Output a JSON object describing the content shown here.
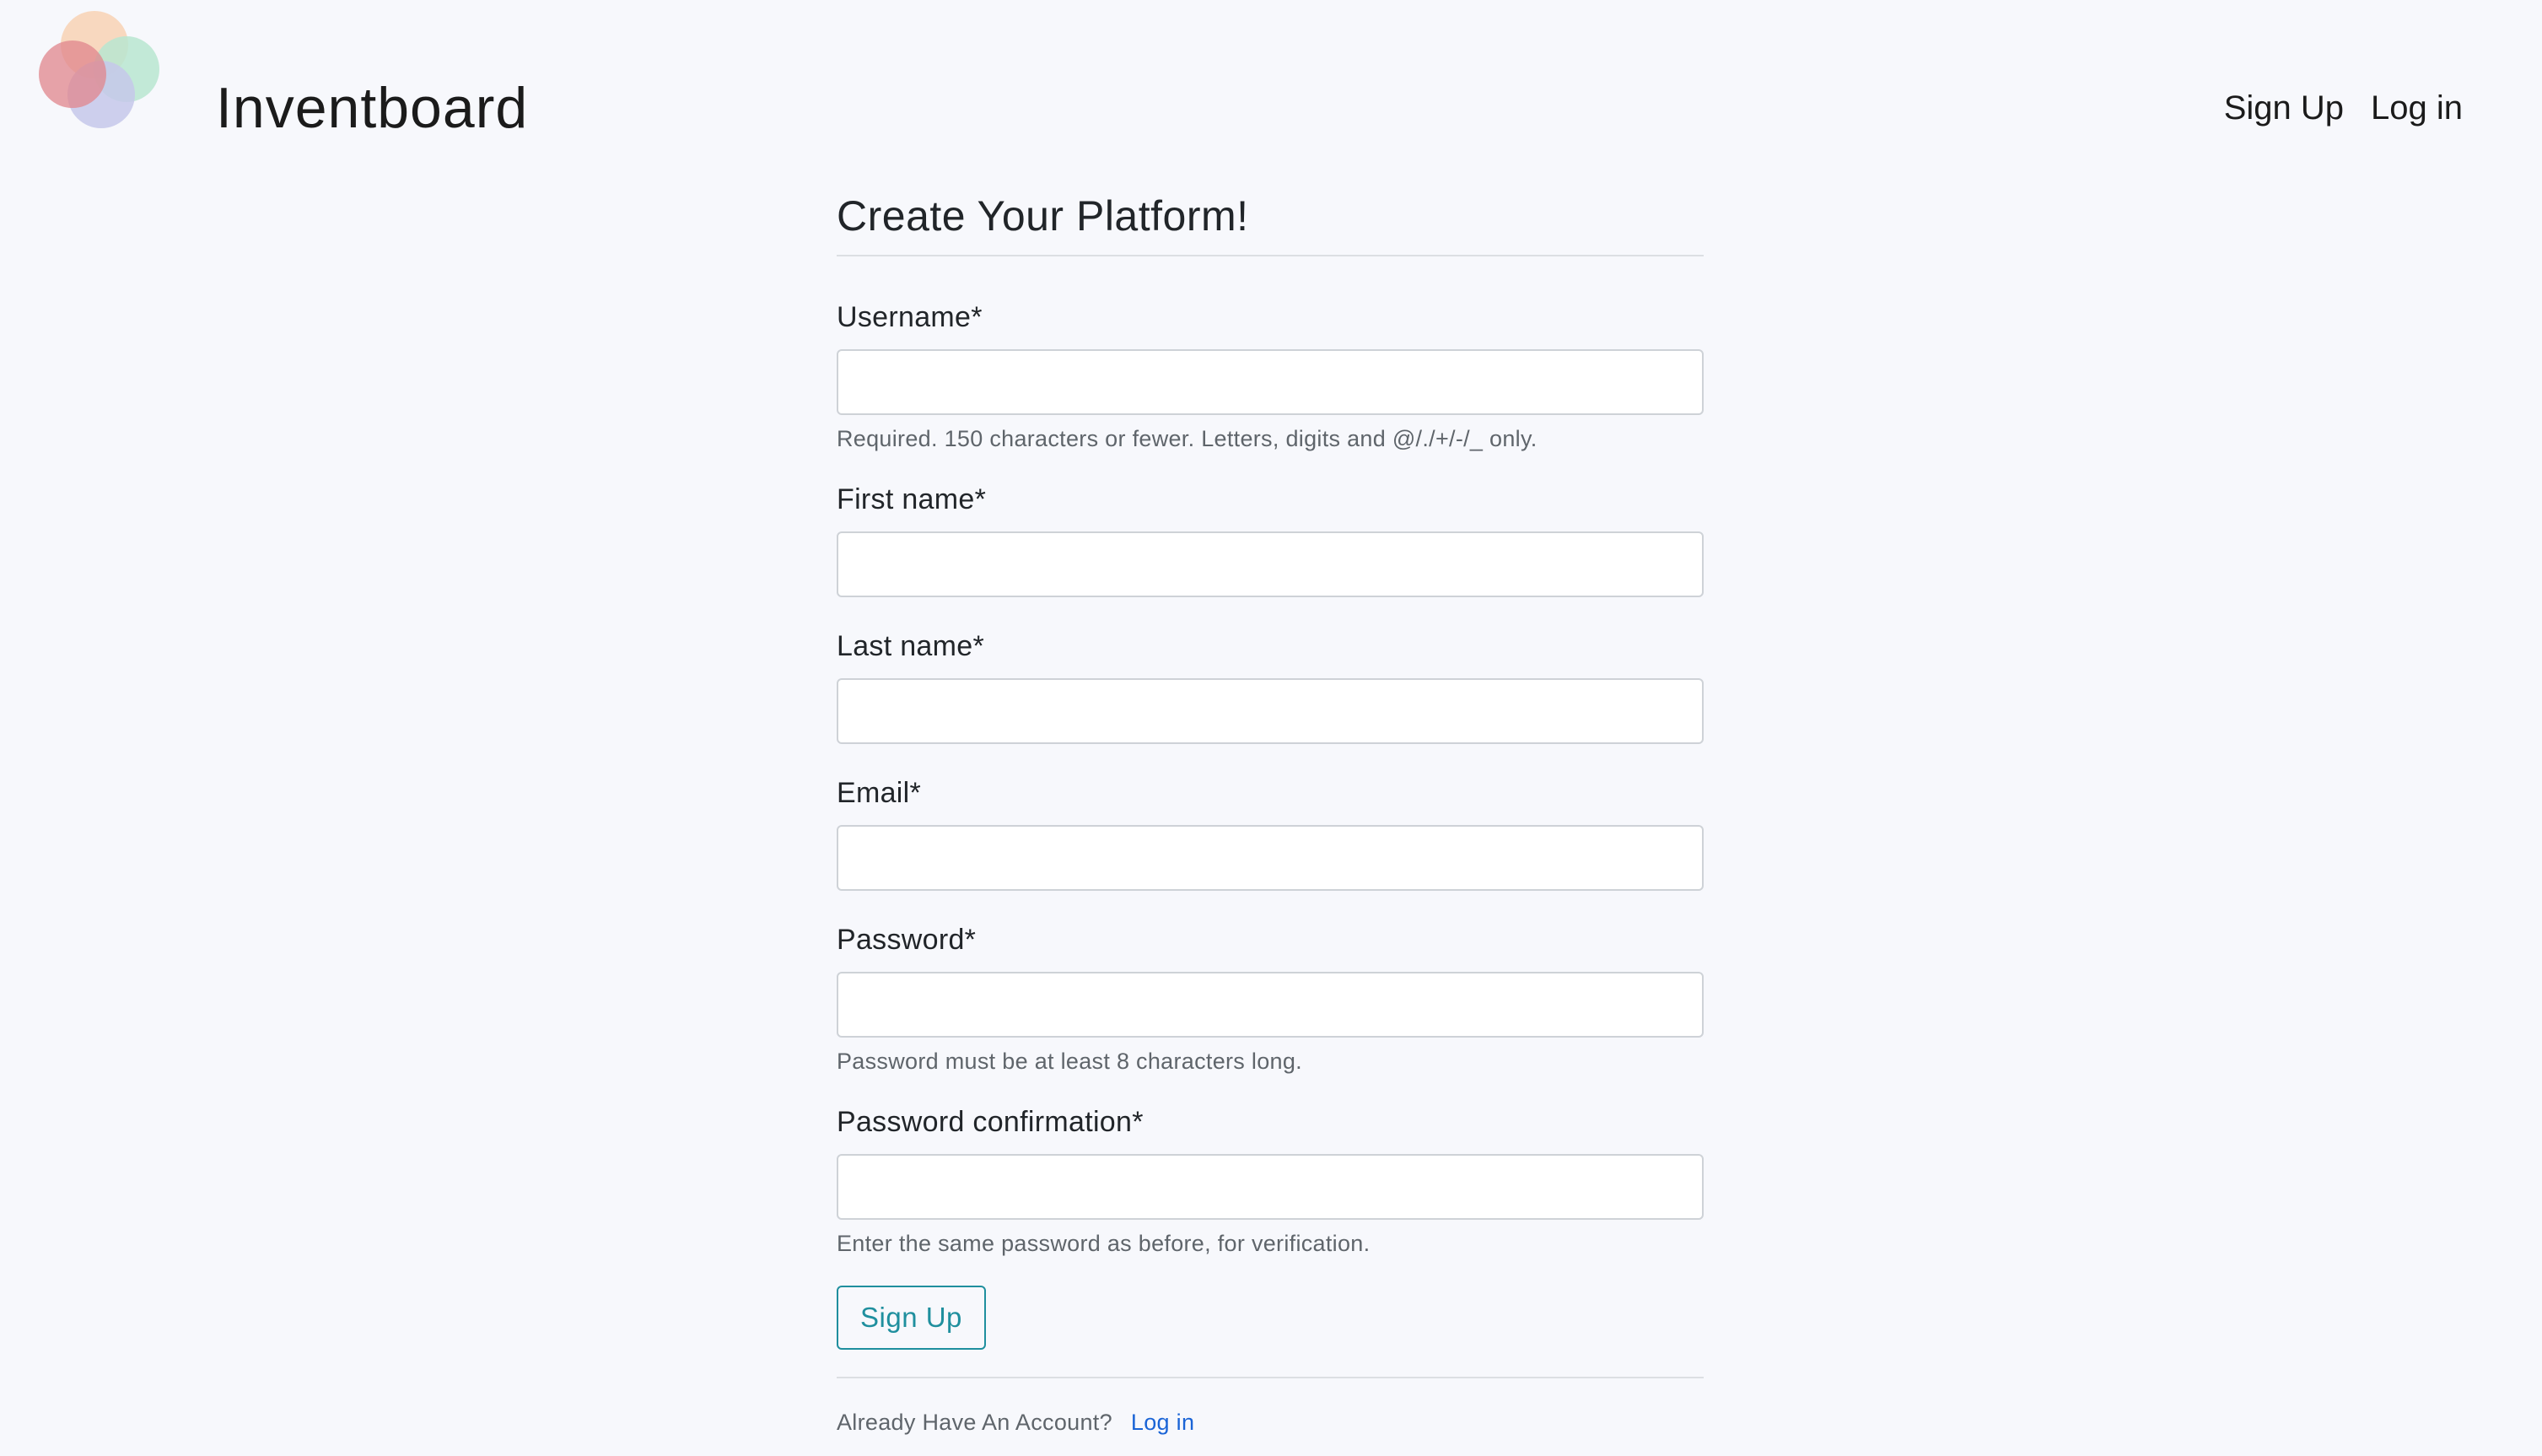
{
  "header": {
    "brand": "Inventboard",
    "nav": {
      "signup_label": "Sign Up",
      "login_label": "Log in"
    }
  },
  "form": {
    "title": "Create Your Platform!",
    "fields": {
      "username": {
        "label": "Username*",
        "value": "",
        "help": "Required. 150 characters or fewer. Letters, digits and @/./+/-/_ only."
      },
      "first_name": {
        "label": "First name*",
        "value": ""
      },
      "last_name": {
        "label": "Last name*",
        "value": ""
      },
      "email": {
        "label": "Email*",
        "value": ""
      },
      "password": {
        "label": "Password*",
        "value": "",
        "help": "Password must be at least 8 characters long."
      },
      "password_confirmation": {
        "label": "Password confirmation*",
        "value": "",
        "help": "Enter the same password as before, for verification."
      }
    },
    "submit_label": "Sign Up",
    "account_prompt": "Already Have An Account?",
    "account_link": "Log in"
  },
  "colors": {
    "background": "#f7f8fc",
    "accent": "#1f8f9e",
    "link": "#1a64d6",
    "logo_circles": [
      "#f7d4b8",
      "#b9e6d0",
      "#c6c8ea",
      "#e0858c"
    ]
  },
  "icons": {
    "logo": "overlapping-circles-logo"
  }
}
